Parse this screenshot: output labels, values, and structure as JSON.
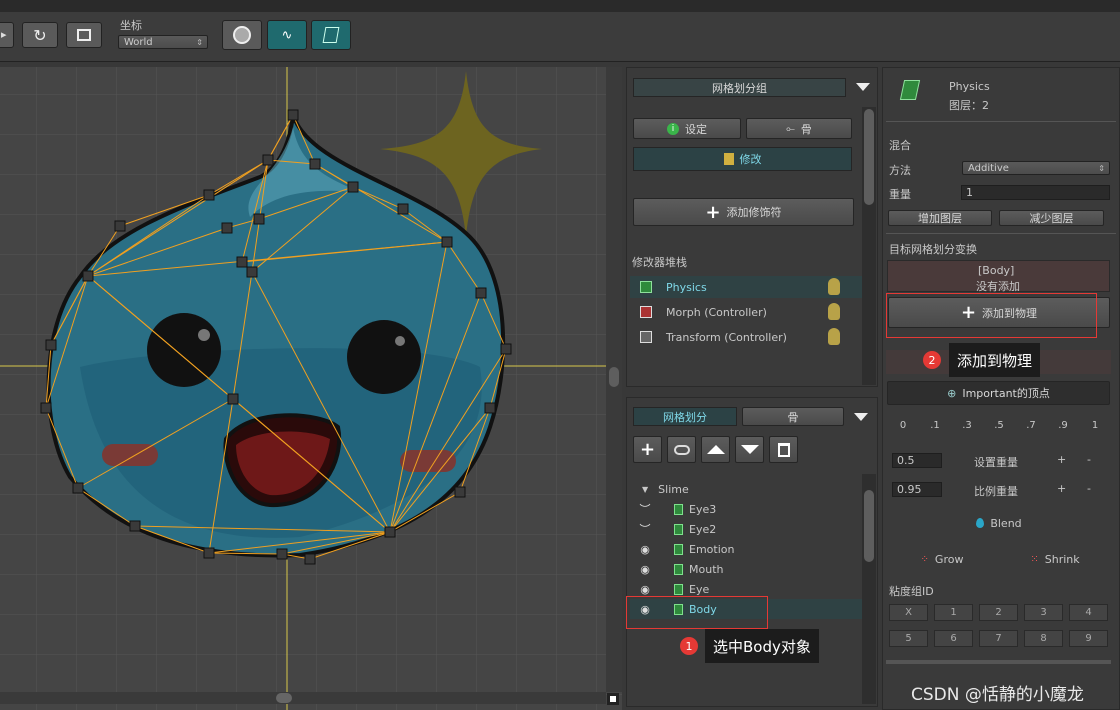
{
  "toolbar": {
    "coord_label": "坐标",
    "coord_value": "World"
  },
  "mesh_group": {
    "title": "网格划分组",
    "tab_setting": "设定",
    "tab_bone": "骨",
    "modify_label": "修改",
    "add_modifier": "添加修饰符",
    "stack_title": "修改器堆栈",
    "modifiers": [
      {
        "label": "Physics"
      },
      {
        "label": "Morph (Controller)"
      },
      {
        "label": "Transform (Controller)"
      }
    ]
  },
  "mesh_panel": {
    "tab_mesh": "网格划分",
    "tab_bone": "骨",
    "tree_root": "Slime",
    "items": [
      {
        "label": "Eye3"
      },
      {
        "label": "Eye2"
      },
      {
        "label": "Emotion"
      },
      {
        "label": "Mouth"
      },
      {
        "label": "Eye"
      },
      {
        "label": "Body"
      }
    ]
  },
  "right_panel": {
    "title": "Physics",
    "layer": "图层：2",
    "blend_label": "混合",
    "method_label": "方法",
    "method_value": "Additive",
    "weight_label": "重量",
    "weight_value": "1",
    "add_layer": "增加图层",
    "reduce_layer": "减少图层",
    "target_label": "目标网格划分变换",
    "target_name": "[Body]",
    "target_status": "没有添加",
    "add_to_physics": "添加到物理",
    "important_vertex": "Important的顶点",
    "weights": [
      "0",
      ".1",
      ".3",
      ".5",
      ".7",
      ".9",
      "1"
    ],
    "set_weight_value": "0.5",
    "set_weight_label": "设置重量",
    "ratio_weight_value": "0.95",
    "ratio_weight_label": "比例重量",
    "plus": "+",
    "minus": "-",
    "blend_btn": "Blend",
    "grow_btn": "Grow",
    "shrink_btn": "Shrink",
    "sticky_label": "粘度组ID",
    "sticky_ids": [
      "X",
      "1",
      "2",
      "3",
      "4",
      "5",
      "6",
      "7",
      "8",
      "9"
    ]
  },
  "annotations": {
    "step1_num": "1",
    "step1_text": "选中Body对象",
    "step2_num": "2",
    "step2_text": "添加到物理",
    "watermark": "CSDN @恬静的小魔龙"
  },
  "colors": {
    "panel_bg": "#383838",
    "accent_teal": "#2c4245",
    "selected_text": "#7fd8e8",
    "highlight_red": "#e53935",
    "mesh_line": "#f0a020"
  }
}
